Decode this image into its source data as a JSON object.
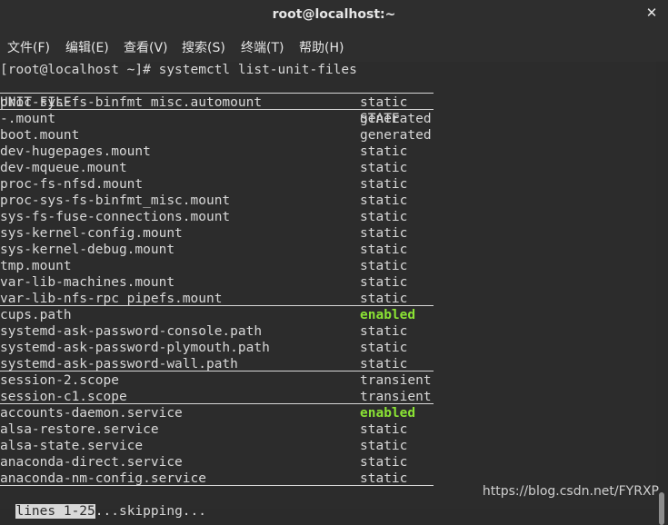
{
  "window": {
    "title": "root@localhost:~",
    "close_glyph": "✕"
  },
  "menu": [
    "文件(F)",
    "编辑(E)",
    "查看(V)",
    "搜索(S)",
    "终端(T)",
    "帮助(H)"
  ],
  "prompt": "[root@localhost ~]# systemctl list-unit-files",
  "header": {
    "unit": "UNIT FILE",
    "state": "STATE"
  },
  "units": [
    {
      "name": "proc-sys-fs-binfmt_misc.automount",
      "state": "static"
    },
    {
      "name": "-.mount",
      "state": "generated"
    },
    {
      "name": "boot.mount",
      "state": "generated"
    },
    {
      "name": "dev-hugepages.mount",
      "state": "static"
    },
    {
      "name": "dev-mqueue.mount",
      "state": "static"
    },
    {
      "name": "proc-fs-nfsd.mount",
      "state": "static"
    },
    {
      "name": "proc-sys-fs-binfmt_misc.mount",
      "state": "static"
    },
    {
      "name": "sys-fs-fuse-connections.mount",
      "state": "static"
    },
    {
      "name": "sys-kernel-config.mount",
      "state": "static"
    },
    {
      "name": "sys-kernel-debug.mount",
      "state": "static"
    },
    {
      "name": "tmp.mount",
      "state": "static"
    },
    {
      "name": "var-lib-machines.mount",
      "state": "static"
    },
    {
      "name": "var-lib-nfs-rpc_pipefs.mount",
      "state": "static"
    },
    {
      "name": "cups.path",
      "state": "enabled"
    },
    {
      "name": "systemd-ask-password-console.path",
      "state": "static"
    },
    {
      "name": "systemd-ask-password-plymouth.path",
      "state": "static"
    },
    {
      "name": "systemd-ask-password-wall.path",
      "state": "static"
    },
    {
      "name": "session-2.scope",
      "state": "transient"
    },
    {
      "name": "session-c1.scope",
      "state": "transient"
    },
    {
      "name": "accounts-daemon.service",
      "state": "enabled"
    },
    {
      "name": "alsa-restore.service",
      "state": "static"
    },
    {
      "name": "alsa-state.service",
      "state": "static"
    },
    {
      "name": "anaconda-direct.service",
      "state": "static"
    },
    {
      "name": "anaconda-nm-config.service",
      "state": "static"
    }
  ],
  "pager": {
    "highlight": "lines 1-25",
    "rest": "...skipping..."
  },
  "watermark": "https://blog.csdn.net/FYRXP",
  "colors": {
    "enabled": "#8ae234",
    "text": "#d8d8d8",
    "background": "#2c2c2c"
  }
}
